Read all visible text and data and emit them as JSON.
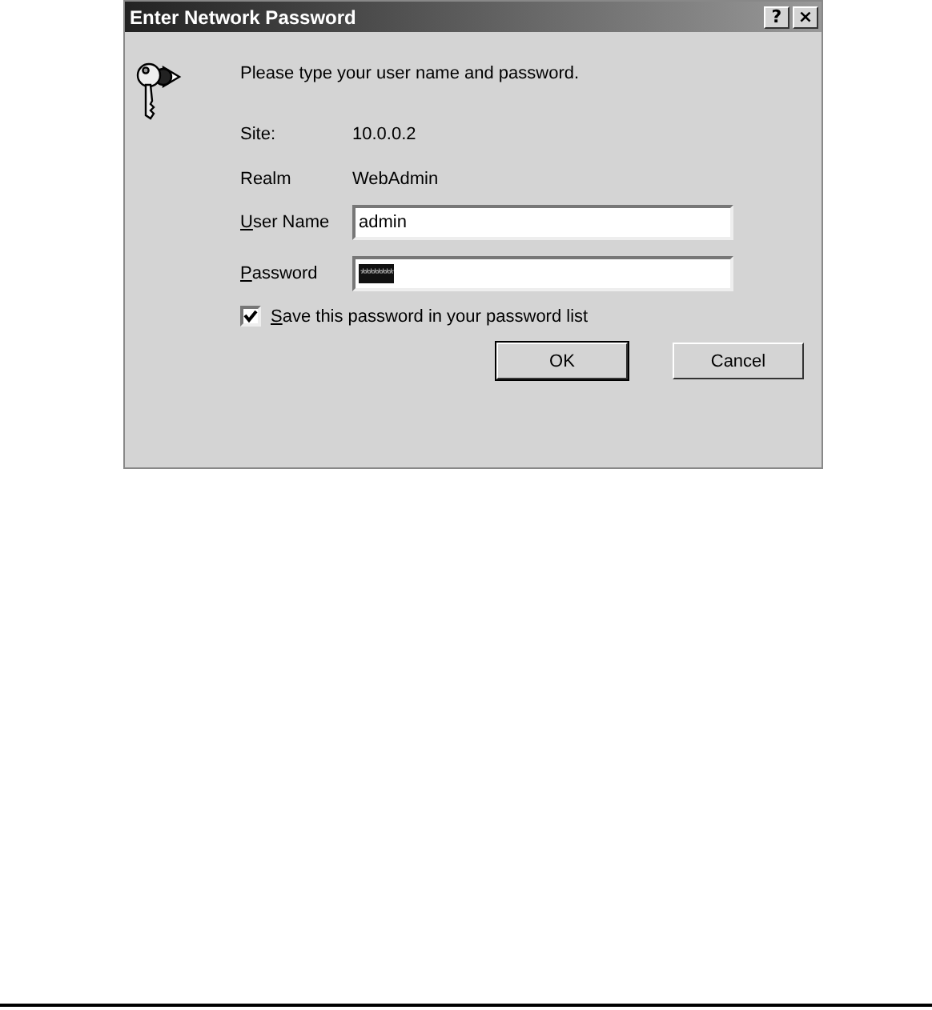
{
  "window": {
    "title": "Enter Network Password",
    "title_buttons": [
      "?",
      "×"
    ]
  },
  "prompt": "Please type your user name and password.",
  "info": [
    {
      "label": "Site:",
      "value": "10.0.0.2"
    },
    {
      "label": "Realm",
      "value": "WebAdmin"
    }
  ],
  "fields": [
    {
      "label": "User Name",
      "value": "admin",
      "selected": false
    },
    {
      "label": "Password",
      "value": "********",
      "selected": true
    }
  ],
  "save_password": {
    "label": "Save this password in your password list",
    "checked": true
  },
  "buttons": [
    "OK",
    "Cancel"
  ]
}
